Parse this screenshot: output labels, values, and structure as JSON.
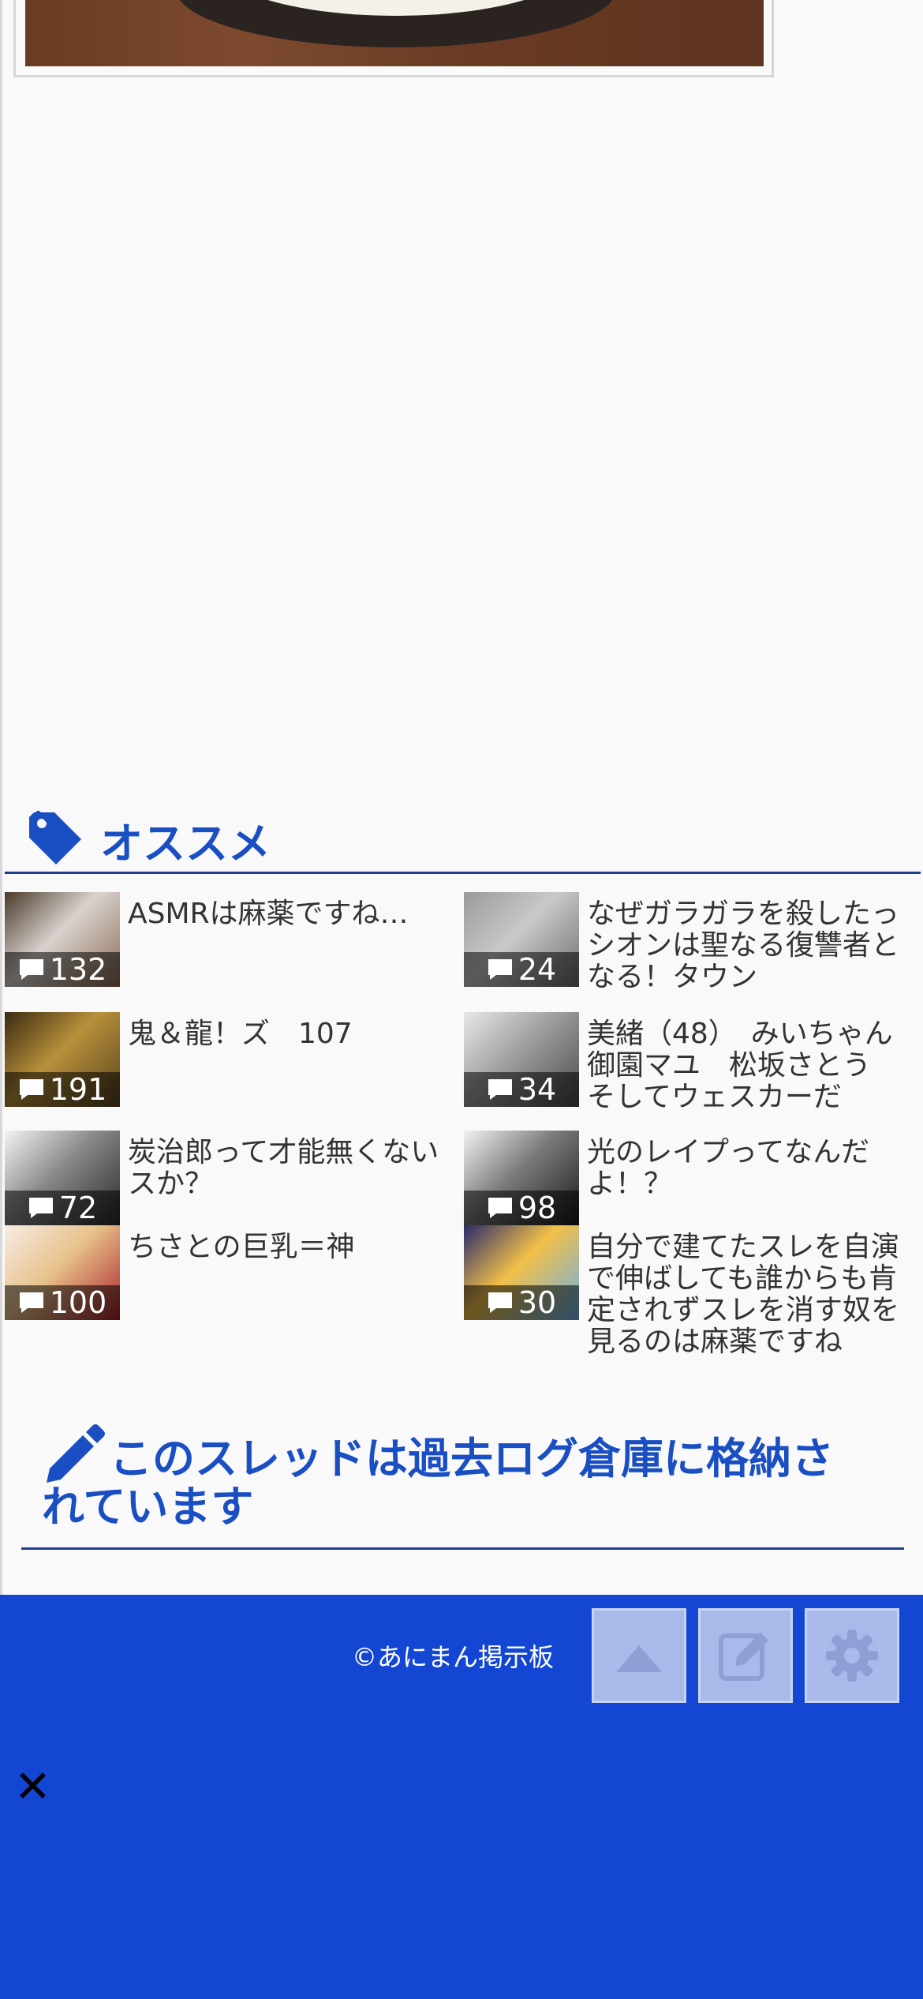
{
  "recommend": {
    "heading": "オススメ",
    "items": [
      {
        "title": "ASMRは麻薬ですね…",
        "count": "132",
        "thumb_colors": [
          "#4a3a2a",
          "#d9d3cf",
          "#8b6b52"
        ]
      },
      {
        "title": "なぜガラガラを殺したっシオンは聖なる復讐者となる！タウン",
        "count": "24",
        "thumb_colors": [
          "#9a9a9a",
          "#c9c9c9",
          "#6d6d6d"
        ]
      },
      {
        "title": "鬼＆龍！ズ　107",
        "count": "191",
        "thumb_colors": [
          "#3a2a12",
          "#b8903a",
          "#5a4420"
        ]
      },
      {
        "title": "美緒（48）　みいちゃん　御園マユ　松坂さとう　そしてウェスカーだ",
        "count": "34",
        "thumb_colors": [
          "#e8e8e8",
          "#9e9e9e",
          "#4a4a4a"
        ]
      },
      {
        "title": "炭治郎って才能無くないスか？",
        "count": "72",
        "thumb_colors": [
          "#f4f4f4",
          "#888888",
          "#2a2a2a"
        ]
      },
      {
        "title": "光のレイプってなんだよ！？",
        "count": "98",
        "thumb_colors": [
          "#f2f2f2",
          "#7a7a7a",
          "#1a1a1a"
        ]
      },
      {
        "title": "ちさとの巨乳＝神",
        "count": "100",
        "thumb_colors": [
          "#f7ece6",
          "#e8c28a",
          "#a8202a"
        ]
      },
      {
        "title": "自分で建てたスレを自演で伸ばしても誰からも肯定されずスレを消す奴を見るのは麻薬ですね",
        "count": "30",
        "thumb_colors": [
          "#2a2a6a",
          "#f2c048",
          "#6ab0e8"
        ]
      }
    ]
  },
  "notice": {
    "text": "このスレッドは過去ログ倉庫に格納されています"
  },
  "footer": {
    "copyright": "©あにまん掲示板",
    "buttons": [
      "scroll-top",
      "write",
      "settings"
    ]
  },
  "close_label": "✕",
  "colors": {
    "accent": "#1a4fc4",
    "footer_bg": "#1246d3",
    "footer_button": "#a9b9ea"
  }
}
